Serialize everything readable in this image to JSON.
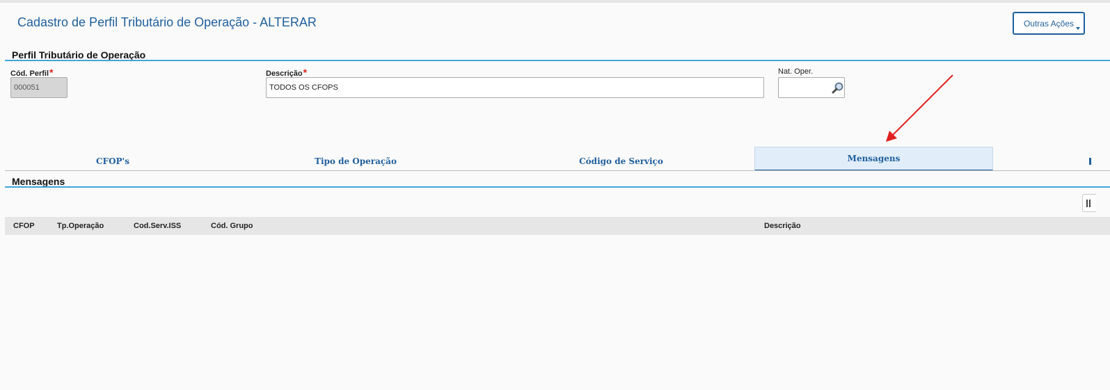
{
  "header": {
    "title": "Cadastro de Perfil Tributário de Operação - ALTERAR",
    "actions_label": "Outras Ações"
  },
  "form_section": {
    "title": "Perfil Tributário de Operação",
    "fields": {
      "cod_perfil": {
        "label": "Cód. Perfil",
        "required_mark": "*",
        "value": "000051"
      },
      "descricao": {
        "label": "Descrição",
        "required_mark": "*",
        "value": "TODOS OS CFOPS"
      },
      "nat_oper": {
        "label": "Nat. Oper.",
        "value": ""
      }
    }
  },
  "tabs": [
    {
      "label": "CFOP's"
    },
    {
      "label": "Tipo de Operação"
    },
    {
      "label": "Código de Serviço"
    },
    {
      "label": "Mensagens",
      "active": true
    }
  ],
  "messages_section": {
    "title": "Mensagens",
    "columns": [
      "CFOP",
      "Tp.Operação",
      "Cod.Serv.ISS",
      "Cód. Grupo",
      "Descrição"
    ],
    "rows": []
  },
  "colors": {
    "accent": "#1f5f9c",
    "section_line": "#42a5d6",
    "annotation_arrow": "#e02020",
    "active_tab_bg": "#e1eef9"
  },
  "icons": {
    "lookup": "magnifier-icon",
    "actions_dropdown": "caret-down-icon",
    "grid_config": "column-config-icon",
    "annotation": "red-arrow"
  }
}
